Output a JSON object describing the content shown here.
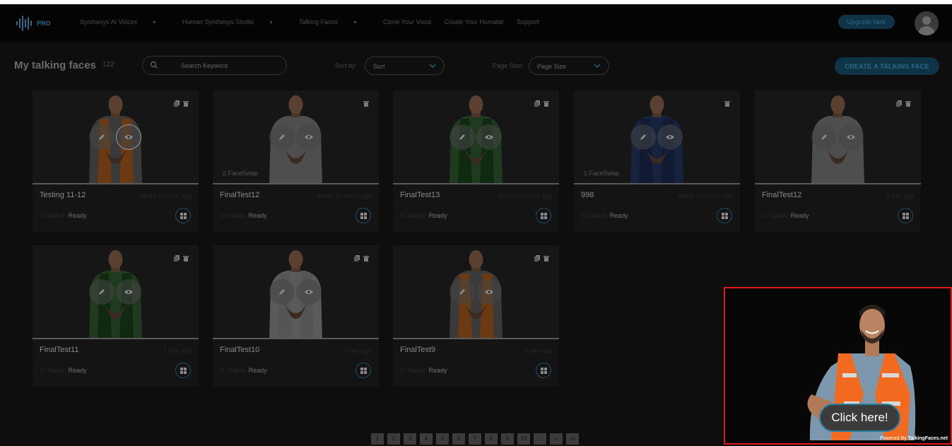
{
  "nav": {
    "logo_badge": "PRO",
    "links": [
      {
        "label": "Synthesys AI Voices",
        "dropdown": true
      },
      {
        "label": "Human Synthesys Studio",
        "dropdown": true
      },
      {
        "label": "Talking Faces",
        "dropdown": true
      },
      {
        "label": "Clone Your Voice",
        "dropdown": false
      },
      {
        "label": "Create Your Humatar",
        "dropdown": false
      },
      {
        "label": "Support",
        "dropdown": false
      }
    ],
    "upgrade_label": "Upgrade here"
  },
  "toolbar": {
    "title": "My talking faces",
    "count": "122",
    "search_placeholder": "Search Keyword",
    "sort_label": "Sort by:",
    "sort_value": "Sort",
    "pagesize_label": "Page Size:",
    "pagesize_value": "Page Size",
    "create_label": "CREATE A TALKING FACE"
  },
  "cards": [
    {
      "name": "Testing 11-12",
      "time": "about 8 hours ago",
      "status_label": "Status:",
      "status": "Ready",
      "badge": "",
      "vest": "#6b3a12",
      "shirt": "#3a3a3a",
      "tools": 2
    },
    {
      "name": "FinalTest12",
      "time": "about 15 hours ago",
      "status_label": "Status:",
      "status": "Ready",
      "badge": "FaceSwap",
      "vest": "#4e4e4e",
      "shirt": "#4e4e4e",
      "tools": 1
    },
    {
      "name": "FinalTest13",
      "time": "about 22 hours ago",
      "status_label": "Status:",
      "status": "Ready",
      "badge": "",
      "vest": "#0f2a10",
      "shirt": "#1f3a1f",
      "tools": 2
    },
    {
      "name": "998",
      "time": "about 23 hours ago",
      "status_label": "Status:",
      "status": "Ready",
      "badge": "FaceSwap",
      "vest": "#101a33",
      "shirt": "#16223e",
      "tools": 1
    },
    {
      "name": "FinalTest12",
      "time": "1 day ago",
      "status_label": "Status:",
      "status": "Ready",
      "badge": "",
      "vest": "#4e4e4e",
      "shirt": "#4e4e4e",
      "tools": 2
    },
    {
      "name": "FinalTest11",
      "time": "1 day ago",
      "status_label": "Status:",
      "status": "Ready",
      "badge": "",
      "vest": "#0f2a10",
      "shirt": "#1f3a1f",
      "tools": 2
    },
    {
      "name": "FinalTest10",
      "time": "1 day ago",
      "status_label": "Status:",
      "status": "Ready",
      "badge": "",
      "vest": "#555555",
      "shirt": "#5a5a5a",
      "tools": 2
    },
    {
      "name": "FinalTest9",
      "time": "1 day ago",
      "status_label": "Status:",
      "status": "Ready",
      "badge": "",
      "vest": "#6b3a12",
      "shirt": "#3a3a3a",
      "tools": 2
    }
  ],
  "pagination": [
    "1",
    "2",
    "3",
    "4",
    "5",
    "6",
    "7",
    "8",
    "9",
    "10",
    "...",
    "»",
    "»»"
  ],
  "widget": {
    "button_label": "Click here!",
    "powered_prefix": "Powered By",
    "powered_brand": "TalkingFaces.net"
  },
  "colors": {
    "accent": "#2a7fa0",
    "highlight_border": "#e0191b"
  }
}
